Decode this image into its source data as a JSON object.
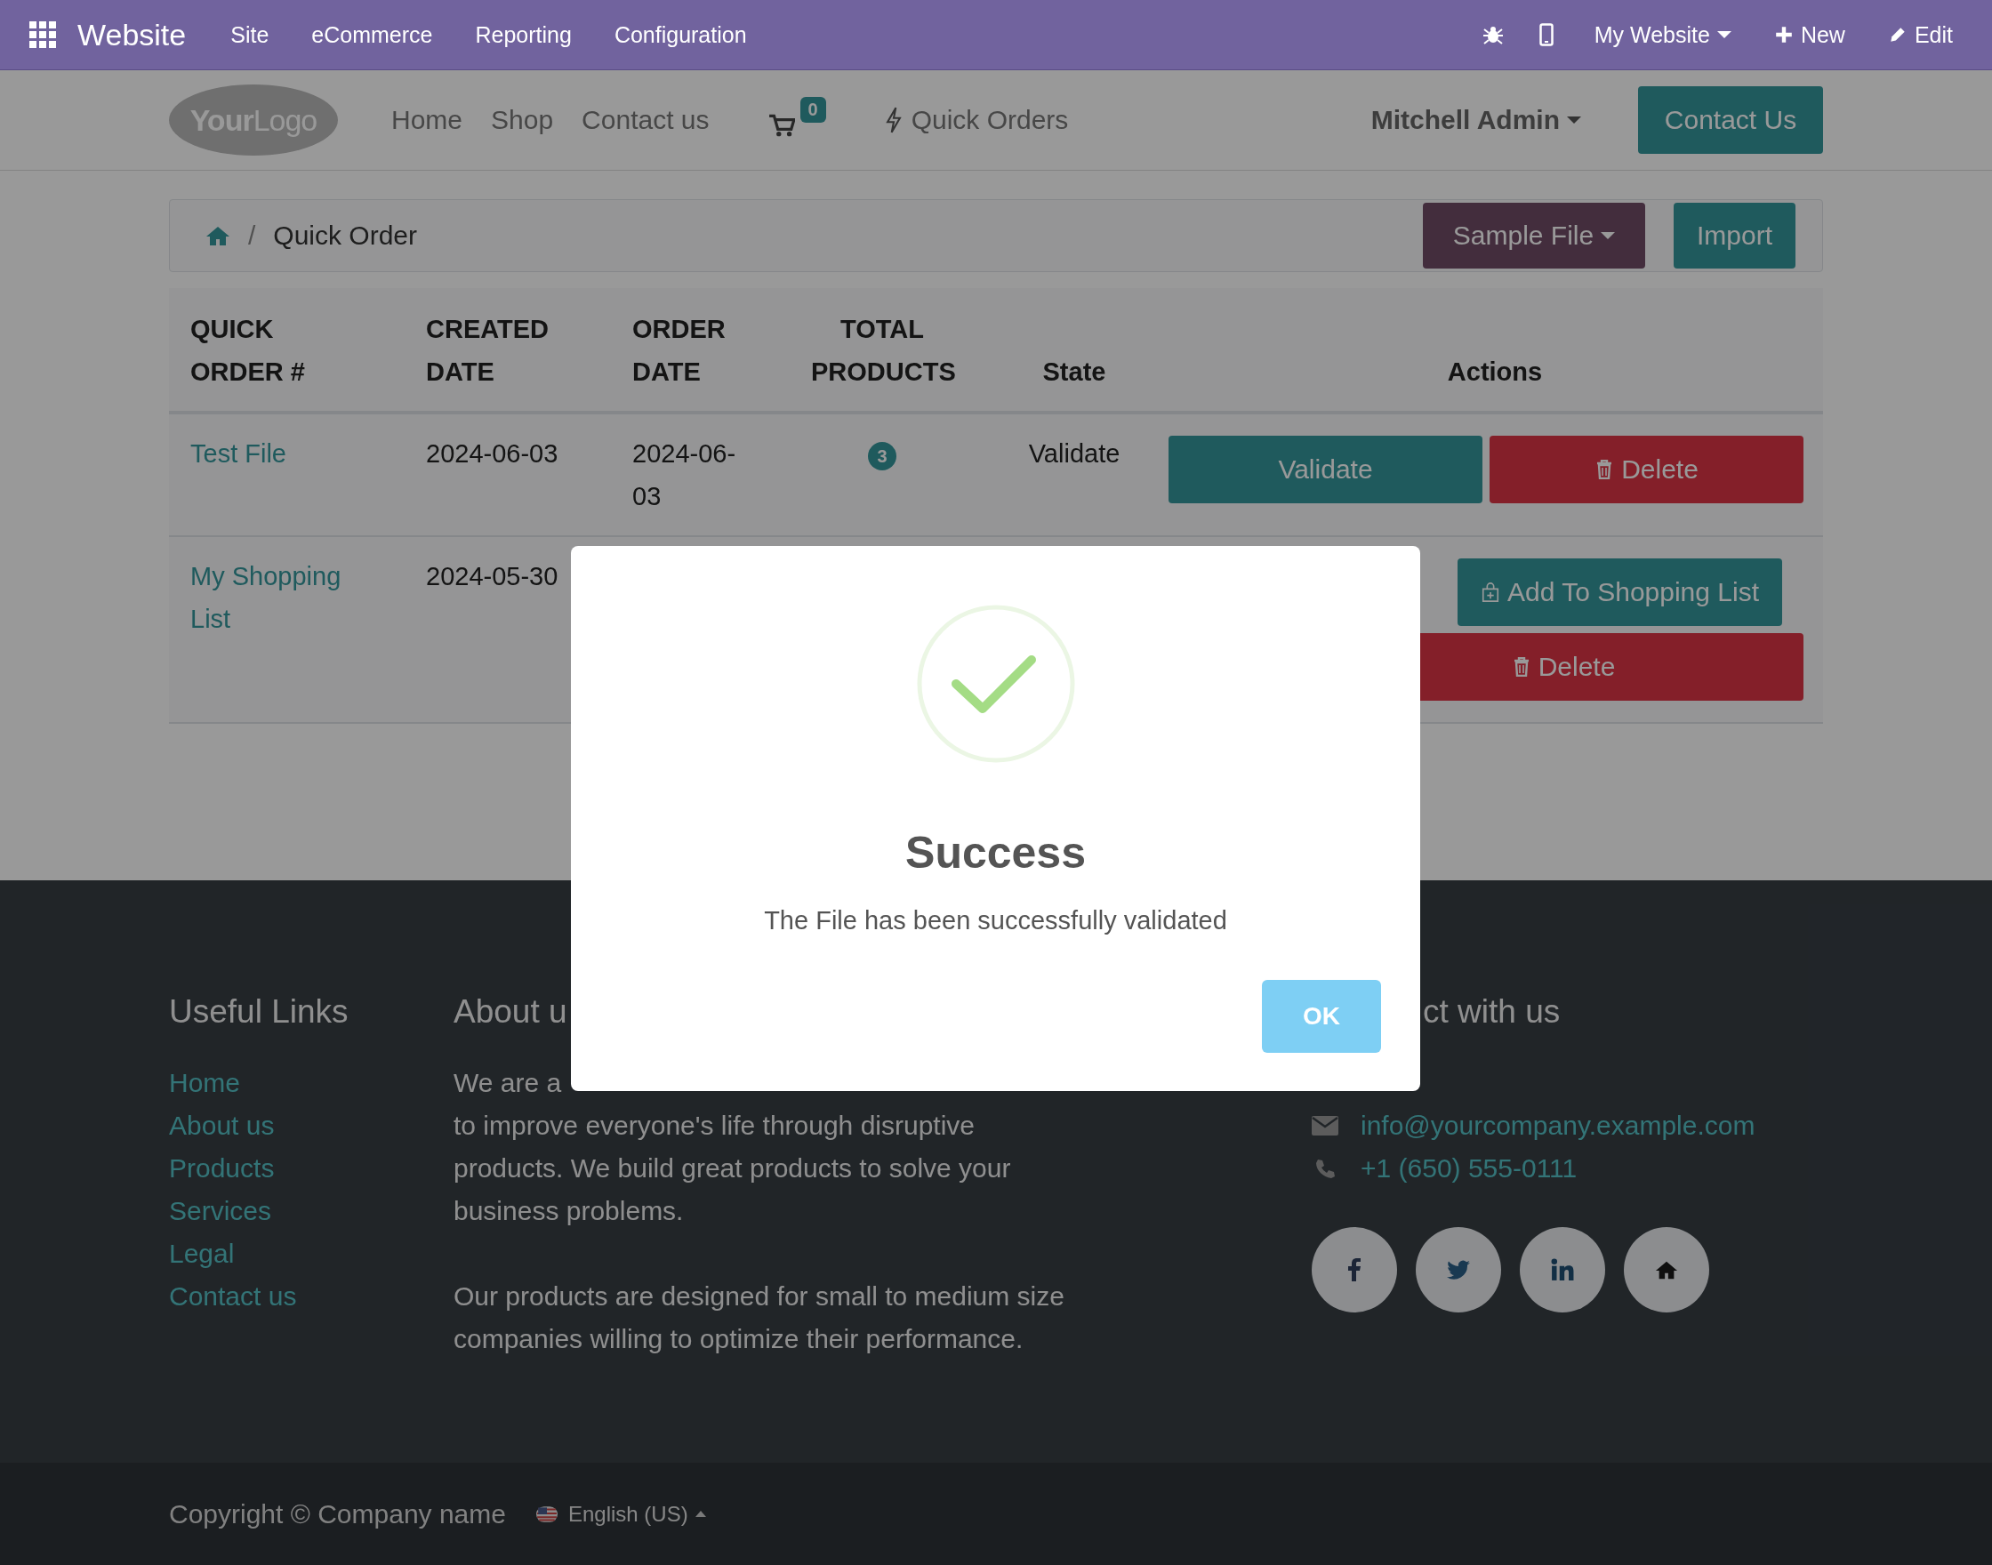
{
  "topbar": {
    "app": "Website",
    "menu": [
      "Site",
      "eCommerce",
      "Reporting",
      "Configuration"
    ],
    "website": "My Website",
    "new": "New",
    "edit": "Edit"
  },
  "header": {
    "logo": "**Your**Logo",
    "nav": [
      "Home",
      "Shop",
      "Contact us"
    ],
    "cart_count": "0",
    "quick_orders": "Quick Orders",
    "user": "Mitchell Admin",
    "contact_button": "Contact Us"
  },
  "breadcrumb": {
    "separator": "/",
    "current": "Quick Order",
    "sample_file": "Sample File",
    "import": "Import"
  },
  "table": {
    "columns": [
      "QUICK ORDER #",
      "CREATED DATE",
      "ORDER DATE",
      "TOTAL PRODUCTS",
      "State",
      "Actions"
    ],
    "rows": [
      {
        "name": "Test File",
        "created": "2024-06-03",
        "order_date": "2024-06-03",
        "total": "3",
        "state": "Validate",
        "actions": [
          {
            "kind": "validate",
            "label": "Validate"
          },
          {
            "kind": "delete",
            "label": "Delete"
          }
        ]
      },
      {
        "name": "My Shopping List",
        "created": "2024-05-30",
        "actions": [
          {
            "kind": "add_to_list",
            "label": "Add To Shopping List"
          },
          {
            "kind": "delete",
            "label": "Delete"
          }
        ]
      }
    ]
  },
  "footer": {
    "useful_links": {
      "title": "Useful Links",
      "links": [
        "Home",
        "About us",
        "Products",
        "Services",
        "Legal",
        "Contact us"
      ]
    },
    "about": {
      "title": "About u",
      "lead": "We are a",
      "text": "to improve everyone's life through disruptive products. We build great products to solve your business problems.",
      "text2": "Our products are designed for small to medium size companies willing to optimize their performance."
    },
    "connect": {
      "title": "ct with us",
      "email": "info@yourcompany.example.com",
      "phone": "+1 (650) 555-0111"
    },
    "social": [
      {
        "kind": "facebook"
      },
      {
        "kind": "twitter"
      },
      {
        "kind": "linkedin"
      },
      {
        "kind": "home"
      }
    ]
  },
  "copyright": {
    "text": "Copyright © Company name",
    "language": "English (US)"
  },
  "dialog": {
    "title": "Success",
    "message": "The File has been successfully validated",
    "ok": "OK"
  }
}
